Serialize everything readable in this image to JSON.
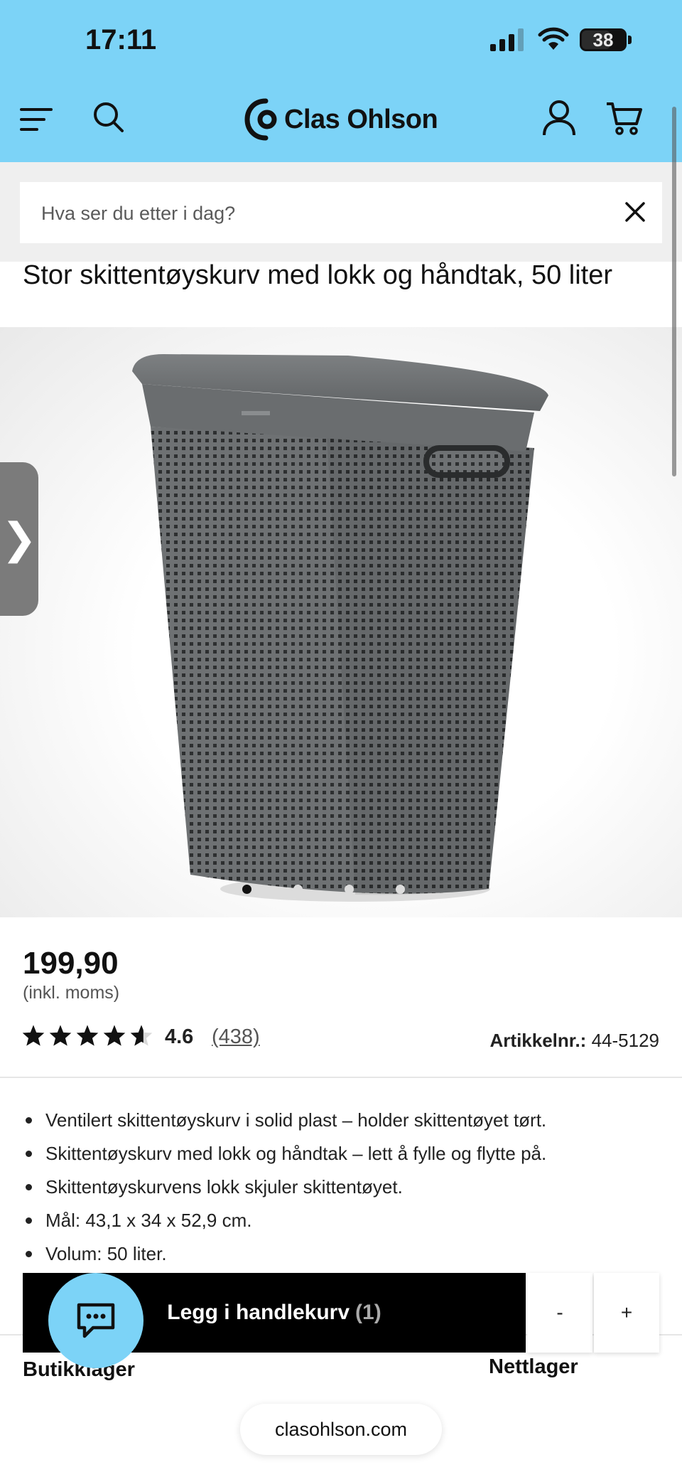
{
  "status_bar": {
    "time": "17:11",
    "battery": "38"
  },
  "header": {
    "brand": "Clas Ohlson"
  },
  "search": {
    "placeholder": "Hva ser du etter i dag?"
  },
  "product": {
    "title": "Stor skittentøyskurv med lokk og håndtak, 50 liter",
    "image_count": 4,
    "active_image": 0,
    "price": "199,90",
    "vat_note": "(inkl. moms)",
    "rating": {
      "value": 4.6,
      "display": "4.6",
      "count": "(438)"
    },
    "article": {
      "label": "Artikkelnr.:",
      "number": "44-5129"
    },
    "bullets": [
      "Ventilert skittentøyskurv i solid plast – holder skittentøyet tørt.",
      "Skittentøyskurv med lokk og håndtak – lett å fylle og flytte på.",
      "Skittentøyskurvens lokk skjuler skittentøyet.",
      "Mål: 43,1 x 34 x 52,9 cm.",
      "Volum: 50 liter."
    ]
  },
  "cart_bar": {
    "add_label": "Legg i handlekurv",
    "count": "(1)",
    "minus": "-",
    "plus": "+"
  },
  "availability": {
    "store": "Butikklager",
    "online": "Nettlager"
  },
  "browser": {
    "url": "clasohlson.com"
  },
  "colors": {
    "brand_blue": "#7cd3f7",
    "cta_black": "#000000"
  }
}
